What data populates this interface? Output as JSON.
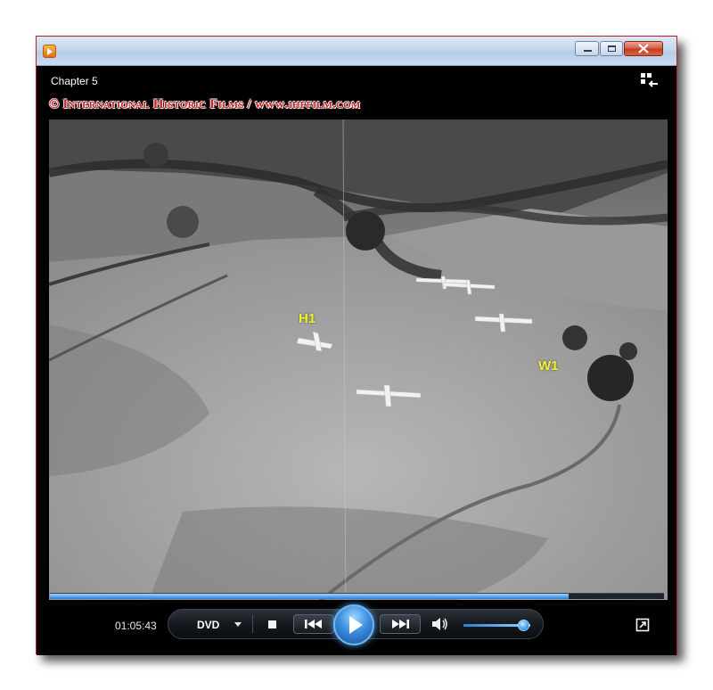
{
  "window": {
    "chapter_title": "Chapter 5",
    "watermark": "© International Historic Films / www.ihffilm.com",
    "border_color": "#b8202a",
    "icons": {
      "app": "media-player-icon",
      "minimize": "minimize-icon",
      "maximize": "maximize-icon",
      "close": "close-icon",
      "switch_view": "switch-to-library-icon"
    }
  },
  "video": {
    "markers": [
      "H1",
      "W1"
    ],
    "marker_color": "#f3f22a"
  },
  "playback": {
    "time": "01:05:43",
    "progress": 0.845,
    "dvd_label": "DVD",
    "volume": 0.9,
    "accent_color": "#2d7ed6",
    "icons": {
      "dvd_menu": "dropdown-caret-icon",
      "stop": "stop-icon",
      "previous": "previous-icon",
      "play": "play-icon",
      "next": "next-icon",
      "volume": "speaker-icon",
      "fullscreen": "fullscreen-icon"
    }
  }
}
